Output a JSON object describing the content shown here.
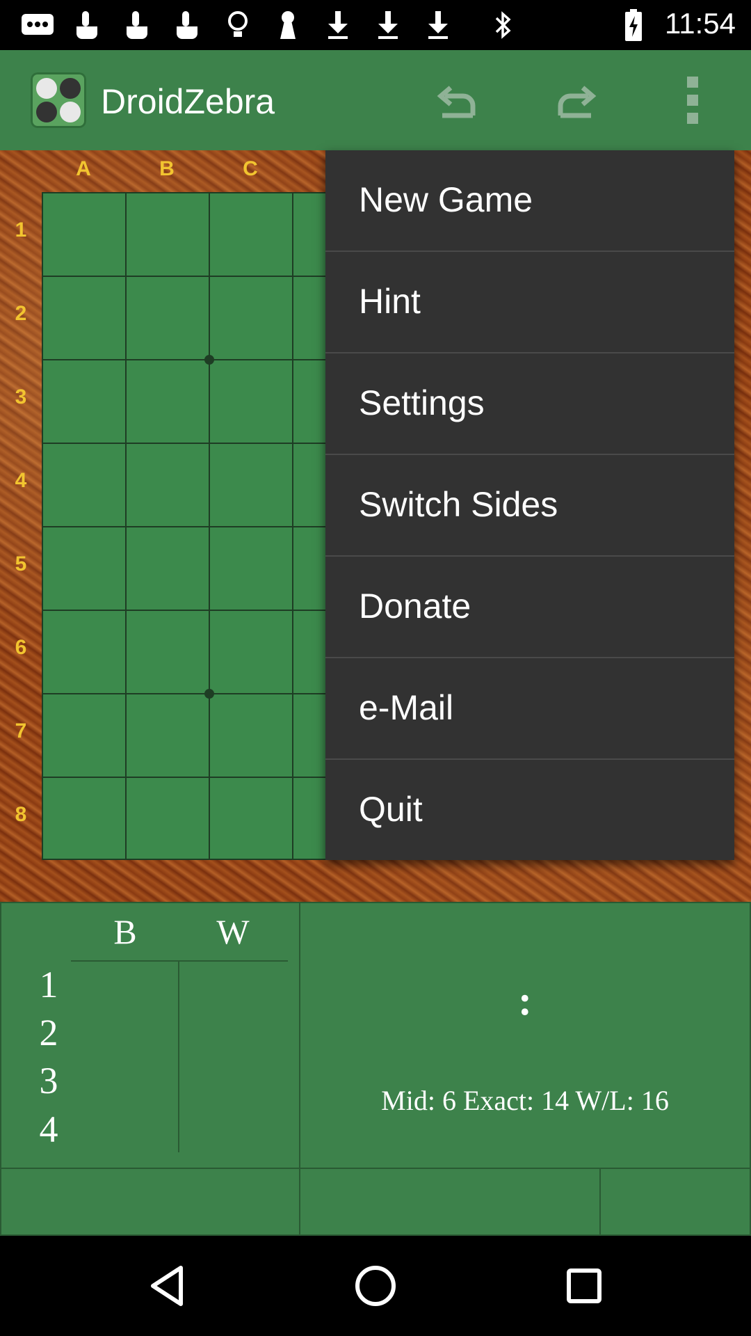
{
  "status_bar": {
    "time": "11:54",
    "icons": [
      "messaging-icon",
      "touch-icon",
      "touch-icon",
      "touch-icon",
      "lightbulb-icon",
      "keyhole-icon",
      "download-icon",
      "download-icon",
      "download-icon",
      "bluetooth-icon",
      "battery-icon"
    ]
  },
  "app_bar": {
    "title": "DroidZebra",
    "actions": [
      "undo-icon",
      "redo-icon",
      "overflow-menu-icon"
    ]
  },
  "board": {
    "columns": [
      "A",
      "B",
      "C"
    ],
    "rows": [
      "1",
      "2",
      "3",
      "4",
      "5",
      "6",
      "7",
      "8"
    ]
  },
  "menu": {
    "items": [
      "New Game",
      "Hint",
      "Settings",
      "Switch Sides",
      "Donate",
      "e-Mail",
      "Quit"
    ]
  },
  "move_list": {
    "header_black": "B",
    "header_white": "W",
    "move_numbers": [
      "1",
      "2",
      "3",
      "4"
    ]
  },
  "status_panel": {
    "score": ":",
    "engine_info": "Mid: 6 Exact: 14 W/L: 16"
  },
  "colors": {
    "app_green": "#3d824b",
    "menu_bg": "#323232",
    "label_yellow": "#f2c530"
  }
}
